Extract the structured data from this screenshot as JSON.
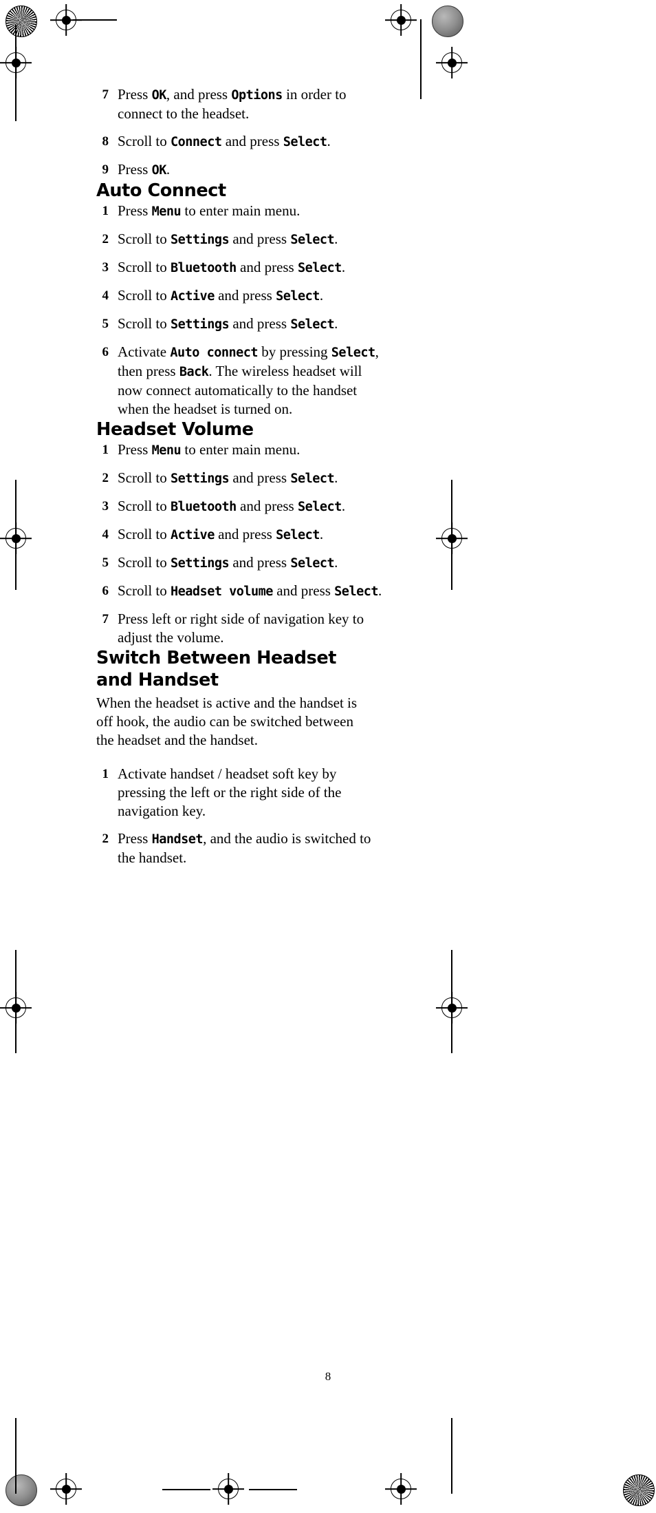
{
  "page": {
    "number": "8"
  },
  "sections": [
    {
      "id": "continued-steps",
      "heading": null,
      "steps": [
        {
          "num": "7",
          "parts": [
            {
              "t": "Press ",
              "ui": false
            },
            {
              "t": "OK",
              "ui": true
            },
            {
              "t": ", and press ",
              "ui": false
            },
            {
              "t": "Options",
              "ui": true
            },
            {
              "t": " in order to connect to the headset.",
              "ui": false
            }
          ]
        },
        {
          "num": "8",
          "parts": [
            {
              "t": "Scroll to ",
              "ui": false
            },
            {
              "t": "Connect",
              "ui": true
            },
            {
              "t": " and press ",
              "ui": false
            },
            {
              "t": "Select",
              "ui": true
            },
            {
              "t": ".",
              "ui": false
            }
          ]
        },
        {
          "num": "9",
          "parts": [
            {
              "t": "Press ",
              "ui": false
            },
            {
              "t": "OK",
              "ui": true
            },
            {
              "t": ".",
              "ui": false
            }
          ]
        }
      ]
    },
    {
      "id": "auto-connect",
      "heading": "Auto Connect",
      "steps": [
        {
          "num": "1",
          "parts": [
            {
              "t": "Press ",
              "ui": false
            },
            {
              "t": "Menu",
              "ui": true
            },
            {
              "t": " to enter main menu.",
              "ui": false
            }
          ]
        },
        {
          "num": "2",
          "parts": [
            {
              "t": "Scroll to ",
              "ui": false
            },
            {
              "t": "Settings",
              "ui": true
            },
            {
              "t": " and press ",
              "ui": false
            },
            {
              "t": "Select",
              "ui": true
            },
            {
              "t": ".",
              "ui": false
            }
          ]
        },
        {
          "num": "3",
          "parts": [
            {
              "t": "Scroll to ",
              "ui": false
            },
            {
              "t": "Bluetooth",
              "ui": true
            },
            {
              "t": " and press ",
              "ui": false
            },
            {
              "t": "Select",
              "ui": true
            },
            {
              "t": ".",
              "ui": false
            }
          ]
        },
        {
          "num": "4",
          "parts": [
            {
              "t": "Scroll to ",
              "ui": false
            },
            {
              "t": "Active",
              "ui": true
            },
            {
              "t": " and press  ",
              "ui": false
            },
            {
              "t": "Select",
              "ui": true
            },
            {
              "t": ".",
              "ui": false
            }
          ]
        },
        {
          "num": "5",
          "parts": [
            {
              "t": "Scroll to ",
              "ui": false
            },
            {
              "t": "Settings",
              "ui": true
            },
            {
              "t": " and press ",
              "ui": false
            },
            {
              "t": "Select",
              "ui": true
            },
            {
              "t": ".",
              "ui": false
            }
          ]
        },
        {
          "num": "6",
          "parts": [
            {
              "t": "Activate ",
              "ui": false
            },
            {
              "t": "Auto connect",
              "ui": true
            },
            {
              "t": " by pressing ",
              "ui": false
            },
            {
              "t": "Select",
              "ui": true
            },
            {
              "t": ", then press ",
              "ui": false
            },
            {
              "t": "Back",
              "ui": true
            },
            {
              "t": ". The wireless headset will now connect automatically to the handset when the headset is turned on.",
              "ui": false
            }
          ]
        }
      ]
    },
    {
      "id": "headset-volume",
      "heading": "Headset Volume",
      "steps": [
        {
          "num": "1",
          "parts": [
            {
              "t": "Press ",
              "ui": false
            },
            {
              "t": "Menu",
              "ui": true
            },
            {
              "t": " to enter main menu.",
              "ui": false
            }
          ]
        },
        {
          "num": "2",
          "parts": [
            {
              "t": "Scroll to ",
              "ui": false
            },
            {
              "t": "Settings",
              "ui": true
            },
            {
              "t": " and press  ",
              "ui": false
            },
            {
              "t": "Select",
              "ui": true
            },
            {
              "t": ".",
              "ui": false
            }
          ]
        },
        {
          "num": "3",
          "parts": [
            {
              "t": "Scroll to ",
              "ui": false
            },
            {
              "t": "Bluetooth",
              "ui": true
            },
            {
              "t": " and press ",
              "ui": false
            },
            {
              "t": "Select",
              "ui": true
            },
            {
              "t": ".",
              "ui": false
            }
          ]
        },
        {
          "num": "4",
          "parts": [
            {
              "t": "Scroll to ",
              "ui": false
            },
            {
              "t": "Active",
              "ui": true
            },
            {
              "t": " and press ",
              "ui": false
            },
            {
              "t": "Select",
              "ui": true
            },
            {
              "t": ".",
              "ui": false
            }
          ]
        },
        {
          "num": "5",
          "parts": [
            {
              "t": "Scroll to ",
              "ui": false
            },
            {
              "t": "Settings",
              "ui": true
            },
            {
              "t": " and press ",
              "ui": false
            },
            {
              "t": "Select",
              "ui": true
            },
            {
              "t": ".",
              "ui": false
            }
          ]
        },
        {
          "num": "6",
          "parts": [
            {
              "t": "Scroll to ",
              "ui": false
            },
            {
              "t": "Headset volume",
              "ui": true
            },
            {
              "t": " and press ",
              "ui": false
            },
            {
              "t": "Select",
              "ui": true
            },
            {
              "t": ".",
              "ui": false
            }
          ]
        },
        {
          "num": "7",
          "parts": [
            {
              "t": "Press left or right side of navigation key to adjust the volume.",
              "ui": false
            }
          ]
        }
      ]
    },
    {
      "id": "switch-between",
      "heading": "Switch Between Headset and Handset",
      "paragraph": "When the headset is active and the handset is off hook, the audio can be switched between the headset and the handset.",
      "steps": [
        {
          "num": "1",
          "parts": [
            {
              "t": "Activate handset / headset soft key by pressing the left or the right side of the navigation key.",
              "ui": false
            }
          ]
        },
        {
          "num": "2",
          "parts": [
            {
              "t": "Press ",
              "ui": false
            },
            {
              "t": "Handset",
              "ui": true
            },
            {
              "t": ", and the audio is switched to the handset.",
              "ui": false
            }
          ]
        }
      ]
    }
  ],
  "printer_marks": {
    "starburst_label": "starburst-calibration-mark",
    "gray_dot_label": "gray-density-calibration-dot",
    "registration_label": "registration-target"
  }
}
